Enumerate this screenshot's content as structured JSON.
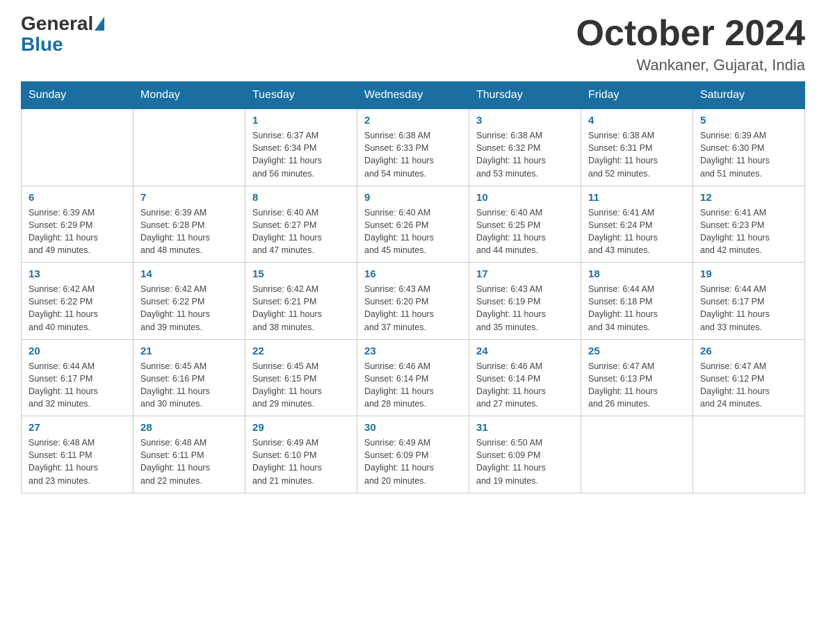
{
  "logo": {
    "general": "General",
    "blue": "Blue"
  },
  "title": "October 2024",
  "location": "Wankaner, Gujarat, India",
  "days_of_week": [
    "Sunday",
    "Monday",
    "Tuesday",
    "Wednesday",
    "Thursday",
    "Friday",
    "Saturday"
  ],
  "weeks": [
    [
      {
        "day": "",
        "info": ""
      },
      {
        "day": "",
        "info": ""
      },
      {
        "day": "1",
        "info": "Sunrise: 6:37 AM\nSunset: 6:34 PM\nDaylight: 11 hours\nand 56 minutes."
      },
      {
        "day": "2",
        "info": "Sunrise: 6:38 AM\nSunset: 6:33 PM\nDaylight: 11 hours\nand 54 minutes."
      },
      {
        "day": "3",
        "info": "Sunrise: 6:38 AM\nSunset: 6:32 PM\nDaylight: 11 hours\nand 53 minutes."
      },
      {
        "day": "4",
        "info": "Sunrise: 6:38 AM\nSunset: 6:31 PM\nDaylight: 11 hours\nand 52 minutes."
      },
      {
        "day": "5",
        "info": "Sunrise: 6:39 AM\nSunset: 6:30 PM\nDaylight: 11 hours\nand 51 minutes."
      }
    ],
    [
      {
        "day": "6",
        "info": "Sunrise: 6:39 AM\nSunset: 6:29 PM\nDaylight: 11 hours\nand 49 minutes."
      },
      {
        "day": "7",
        "info": "Sunrise: 6:39 AM\nSunset: 6:28 PM\nDaylight: 11 hours\nand 48 minutes."
      },
      {
        "day": "8",
        "info": "Sunrise: 6:40 AM\nSunset: 6:27 PM\nDaylight: 11 hours\nand 47 minutes."
      },
      {
        "day": "9",
        "info": "Sunrise: 6:40 AM\nSunset: 6:26 PM\nDaylight: 11 hours\nand 45 minutes."
      },
      {
        "day": "10",
        "info": "Sunrise: 6:40 AM\nSunset: 6:25 PM\nDaylight: 11 hours\nand 44 minutes."
      },
      {
        "day": "11",
        "info": "Sunrise: 6:41 AM\nSunset: 6:24 PM\nDaylight: 11 hours\nand 43 minutes."
      },
      {
        "day": "12",
        "info": "Sunrise: 6:41 AM\nSunset: 6:23 PM\nDaylight: 11 hours\nand 42 minutes."
      }
    ],
    [
      {
        "day": "13",
        "info": "Sunrise: 6:42 AM\nSunset: 6:22 PM\nDaylight: 11 hours\nand 40 minutes."
      },
      {
        "day": "14",
        "info": "Sunrise: 6:42 AM\nSunset: 6:22 PM\nDaylight: 11 hours\nand 39 minutes."
      },
      {
        "day": "15",
        "info": "Sunrise: 6:42 AM\nSunset: 6:21 PM\nDaylight: 11 hours\nand 38 minutes."
      },
      {
        "day": "16",
        "info": "Sunrise: 6:43 AM\nSunset: 6:20 PM\nDaylight: 11 hours\nand 37 minutes."
      },
      {
        "day": "17",
        "info": "Sunrise: 6:43 AM\nSunset: 6:19 PM\nDaylight: 11 hours\nand 35 minutes."
      },
      {
        "day": "18",
        "info": "Sunrise: 6:44 AM\nSunset: 6:18 PM\nDaylight: 11 hours\nand 34 minutes."
      },
      {
        "day": "19",
        "info": "Sunrise: 6:44 AM\nSunset: 6:17 PM\nDaylight: 11 hours\nand 33 minutes."
      }
    ],
    [
      {
        "day": "20",
        "info": "Sunrise: 6:44 AM\nSunset: 6:17 PM\nDaylight: 11 hours\nand 32 minutes."
      },
      {
        "day": "21",
        "info": "Sunrise: 6:45 AM\nSunset: 6:16 PM\nDaylight: 11 hours\nand 30 minutes."
      },
      {
        "day": "22",
        "info": "Sunrise: 6:45 AM\nSunset: 6:15 PM\nDaylight: 11 hours\nand 29 minutes."
      },
      {
        "day": "23",
        "info": "Sunrise: 6:46 AM\nSunset: 6:14 PM\nDaylight: 11 hours\nand 28 minutes."
      },
      {
        "day": "24",
        "info": "Sunrise: 6:46 AM\nSunset: 6:14 PM\nDaylight: 11 hours\nand 27 minutes."
      },
      {
        "day": "25",
        "info": "Sunrise: 6:47 AM\nSunset: 6:13 PM\nDaylight: 11 hours\nand 26 minutes."
      },
      {
        "day": "26",
        "info": "Sunrise: 6:47 AM\nSunset: 6:12 PM\nDaylight: 11 hours\nand 24 minutes."
      }
    ],
    [
      {
        "day": "27",
        "info": "Sunrise: 6:48 AM\nSunset: 6:11 PM\nDaylight: 11 hours\nand 23 minutes."
      },
      {
        "day": "28",
        "info": "Sunrise: 6:48 AM\nSunset: 6:11 PM\nDaylight: 11 hours\nand 22 minutes."
      },
      {
        "day": "29",
        "info": "Sunrise: 6:49 AM\nSunset: 6:10 PM\nDaylight: 11 hours\nand 21 minutes."
      },
      {
        "day": "30",
        "info": "Sunrise: 6:49 AM\nSunset: 6:09 PM\nDaylight: 11 hours\nand 20 minutes."
      },
      {
        "day": "31",
        "info": "Sunrise: 6:50 AM\nSunset: 6:09 PM\nDaylight: 11 hours\nand 19 minutes."
      },
      {
        "day": "",
        "info": ""
      },
      {
        "day": "",
        "info": ""
      }
    ]
  ]
}
